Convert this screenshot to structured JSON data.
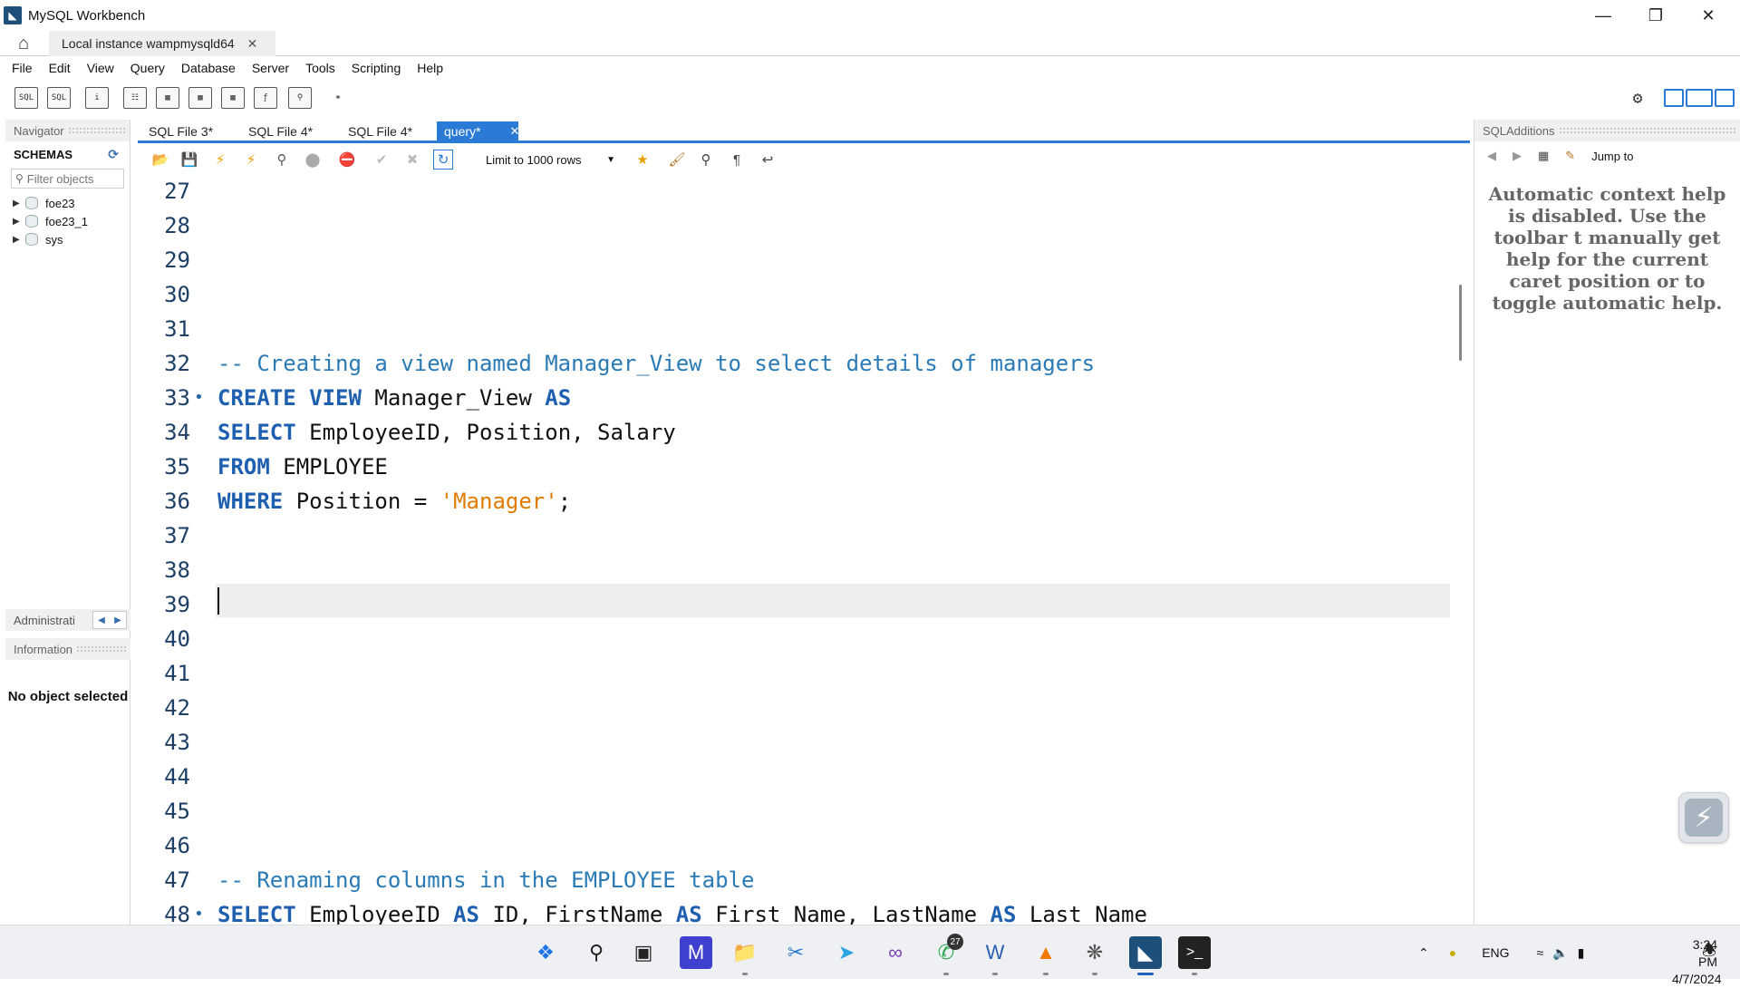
{
  "window": {
    "title": "MySQL Workbench"
  },
  "connection_tab": {
    "label": "Local instance wampmysqld64"
  },
  "menu": [
    "File",
    "Edit",
    "View",
    "Query",
    "Database",
    "Server",
    "Tools",
    "Scripting",
    "Help"
  ],
  "navigator": {
    "header": "Navigator",
    "schemas_label": "SCHEMAS",
    "filter_placeholder": "Filter objects",
    "schemas": [
      "foe23",
      "foe23_1",
      "sys"
    ]
  },
  "administration": {
    "label": "Administrati"
  },
  "information": {
    "header": "Information",
    "no_object": "No object selected"
  },
  "editor_tabs": [
    {
      "label": "SQL File 3*",
      "active": false
    },
    {
      "label": "SQL File 4*",
      "active": false
    },
    {
      "label": "SQL File 4*",
      "active": false
    },
    {
      "label": "query*",
      "active": true
    }
  ],
  "editor_toolbar": {
    "limit_label": "Limit to 1000 rows"
  },
  "code_lines": [
    {
      "no": "27",
      "marker": "",
      "text": ""
    },
    {
      "no": "28",
      "marker": "",
      "text": ""
    },
    {
      "no": "29",
      "marker": "",
      "text": ""
    },
    {
      "no": "30",
      "marker": "",
      "text": ""
    },
    {
      "no": "31",
      "marker": "",
      "text": ""
    },
    {
      "no": "32",
      "marker": "",
      "text": "-- Creating a view named Manager_View to select details of managers"
    },
    {
      "no": "33",
      "marker": "•",
      "text": "CREATE VIEW Manager_View AS"
    },
    {
      "no": "34",
      "marker": "",
      "text": "SELECT EmployeeID, Position, Salary"
    },
    {
      "no": "35",
      "marker": "",
      "text": "FROM EMPLOYEE"
    },
    {
      "no": "36",
      "marker": "",
      "text": "WHERE Position = 'Manager';"
    },
    {
      "no": "37",
      "marker": "",
      "text": ""
    },
    {
      "no": "38",
      "marker": "",
      "text": ""
    },
    {
      "no": "39",
      "marker": "",
      "text": ""
    },
    {
      "no": "40",
      "marker": "",
      "text": ""
    },
    {
      "no": "41",
      "marker": "",
      "text": ""
    },
    {
      "no": "42",
      "marker": "",
      "text": ""
    },
    {
      "no": "43",
      "marker": "",
      "text": ""
    },
    {
      "no": "44",
      "marker": "",
      "text": ""
    },
    {
      "no": "45",
      "marker": "",
      "text": ""
    },
    {
      "no": "46",
      "marker": "",
      "text": ""
    },
    {
      "no": "47",
      "marker": "",
      "text": "-- Renaming columns in the EMPLOYEE table"
    },
    {
      "no": "48",
      "marker": "•",
      "text": "SELECT EmployeeID AS ID, FirstName AS First_Name, LastName AS Last_Name"
    }
  ],
  "current_line": "39",
  "sql_additions": {
    "header": "SQLAdditions",
    "jump_to": "Jump to",
    "context_help": "Automatic context help is disabled. Use the toolbar t manually get help for the current caret position or to toggle automatic help."
  },
  "taskbar": {
    "whatsapp_badge": "27",
    "language": "ENG",
    "time": "3:24 PM",
    "date": "4/7/2024"
  },
  "colors": {
    "accent": "#2a7ad6",
    "keyword": "#1e5fb0",
    "comment": "#2a7ab5",
    "string": "#e07b00"
  }
}
